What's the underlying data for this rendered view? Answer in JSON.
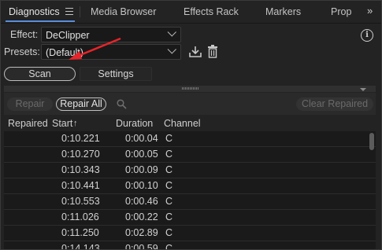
{
  "tabs": [
    {
      "label": "Diagnostics",
      "active": true
    },
    {
      "label": "Media Browser"
    },
    {
      "label": "Effects Rack"
    },
    {
      "label": "Markers"
    },
    {
      "label": "Prop"
    }
  ],
  "tab_menu_icon": "hamburger-icon",
  "overflow_icon": "»",
  "effect": {
    "label": "Effect:",
    "value": "DeClipper"
  },
  "presets": {
    "label": "Presets:",
    "value": "(Default)"
  },
  "info_icon": "i",
  "scan_label": "Scan",
  "settings_label": "Settings",
  "toolbar": {
    "repair_label": "Repair",
    "repair_all_label": "Repair All",
    "clear_repaired_label": "Clear Repaired"
  },
  "table": {
    "headers": {
      "repaired": "Repaired",
      "start": "Start",
      "start_sort": "↑",
      "duration": "Duration",
      "channel": "Channel"
    },
    "rows": [
      {
        "start": "0:10.221",
        "duration": "0:00.04",
        "channel": "C"
      },
      {
        "start": "0:10.270",
        "duration": "0:00.05",
        "channel": "C"
      },
      {
        "start": "0:10.343",
        "duration": "0:00.09",
        "channel": "C"
      },
      {
        "start": "0:10.441",
        "duration": "0:00.10",
        "channel": "C"
      },
      {
        "start": "0:10.553",
        "duration": "0:00.46",
        "channel": "C"
      },
      {
        "start": "0:11.026",
        "duration": "0:00.22",
        "channel": "C"
      },
      {
        "start": "0:11.250",
        "duration": "0:02.89",
        "channel": "C"
      },
      {
        "start": "0:14.143",
        "duration": "0:00.59",
        "channel": "C"
      }
    ]
  },
  "colors": {
    "accent": "#5a8ddb",
    "annotation_arrow": "#e8242a"
  }
}
